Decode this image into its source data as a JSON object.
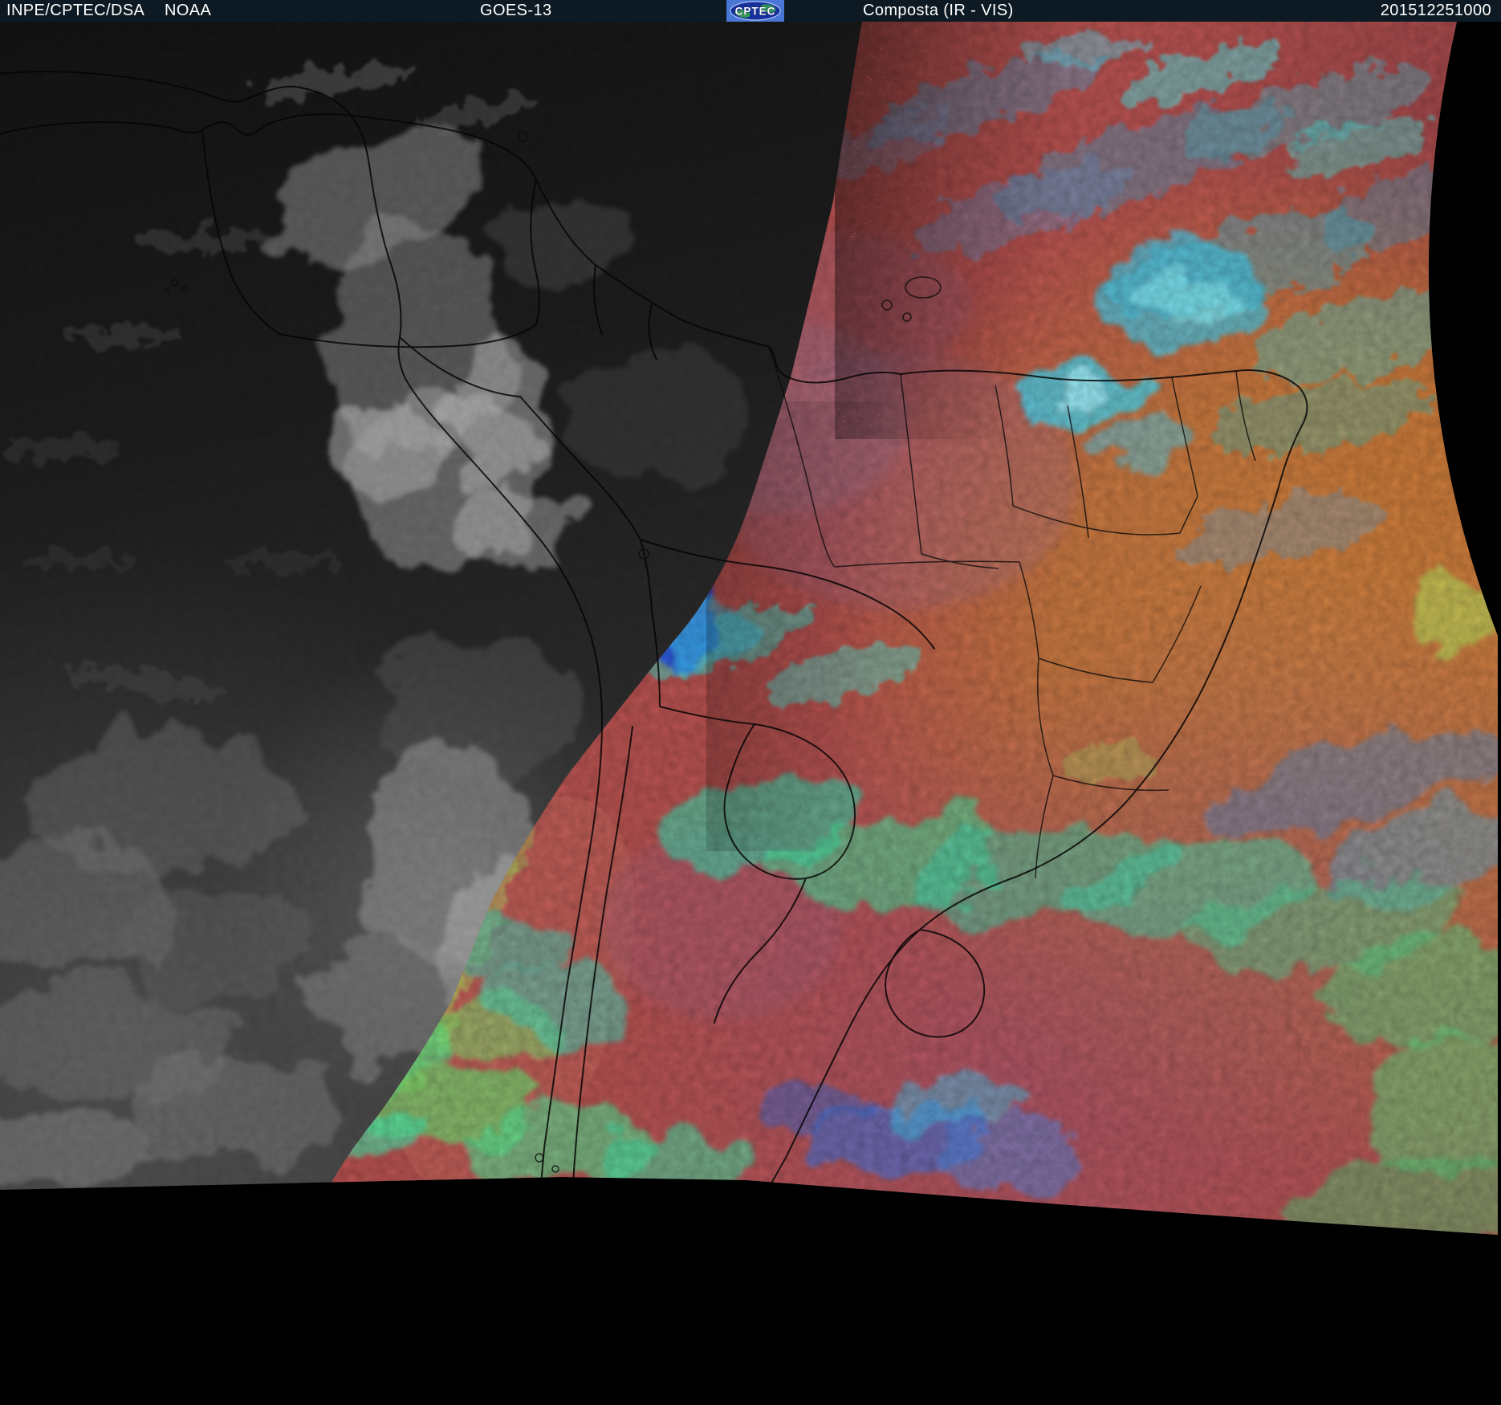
{
  "header": {
    "agency": "INPE/CPTEC/DSA",
    "noaa_label": "NOAA",
    "satellite": "GOES-13",
    "logo_text": "CPTEC",
    "product": "Composta (IR - VIS)",
    "timestamp": "201512251000",
    "bar_color": "#0d1a23",
    "text_color": "#ffffff"
  },
  "image": {
    "palette": {
      "background_black": "#000000",
      "night_ir_gray": "#2a2a2a",
      "night_cloud_gray": "#9a9a9a",
      "day_warm_red": "#b2504e",
      "ocean_warm_orange": "#c67a3c",
      "cool_magenta": "#a3546e",
      "cold_cloud_cyan": "#3fc8e0",
      "cold_cloud_green": "#52d88c",
      "deep_cold_blue": "#2050e0",
      "steel_blue_streak": "#5a8fae",
      "terminator_glint": "#b8cc5a",
      "border_line": "#000000"
    }
  }
}
